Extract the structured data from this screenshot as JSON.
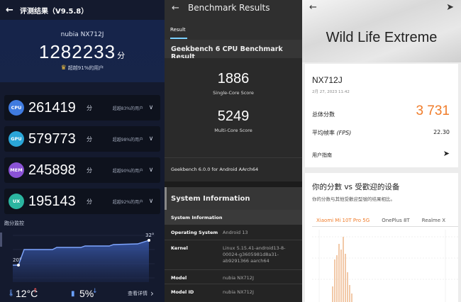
{
  "antutu": {
    "title": "评测结果（V9.5.8）",
    "device": "nubia NX712J",
    "total": "1282233",
    "total_unit": "分",
    "beat": "超越91%的用户",
    "rows": [
      {
        "badge": "CPU",
        "value": "261419",
        "unit": "分",
        "beat": "超越83%的用户",
        "color": "#3f7be0"
      },
      {
        "badge": "GPU",
        "value": "579773",
        "unit": "分",
        "beat": "超越98%的用户",
        "color": "#2aa6d8"
      },
      {
        "badge": "MEM",
        "value": "245898",
        "unit": "分",
        "beat": "超越90%的用户",
        "color": "#8a52d6"
      },
      {
        "badge": "UX",
        "value": "195143",
        "unit": "分",
        "beat": "超越92%的用户",
        "color": "#2bb5a0"
      }
    ],
    "monitor_label": "跑分监控",
    "temp_start": "20°",
    "temp_end": "32°",
    "temp_rise": "12°C",
    "battery_drop": "5%",
    "detail": "查看详情"
  },
  "geekbench": {
    "title": "Benchmark Results",
    "tab": "Result",
    "heading": "Geekbench 6 CPU Benchmark Result",
    "single_score": "1886",
    "single_label": "Single-Core Score",
    "multi_score": "5249",
    "multi_label": "Multi-Core Score",
    "version": "Geekbench 6.0.0 for Android AArch64",
    "sys_title": "System Information",
    "table_head": "System Information",
    "rows": [
      {
        "k": "Operating System",
        "v": "Android 13"
      },
      {
        "k": "Kernel",
        "v": "Linux 5.15.41-android13-8-00024-g3605981d8a31-ab9291366 aarch64"
      },
      {
        "k": "Model",
        "v": "nubia NX712J"
      },
      {
        "k": "Model ID",
        "v": "nubia NX712J"
      }
    ]
  },
  "threedmark": {
    "title": "Wild Life Extreme",
    "device": "NX712J",
    "date": "2月 27, 2023 11:42",
    "score_label": "总体分数",
    "score": "3 731",
    "fps_label": "平均帧率",
    "fps_label_en": "(FPS)",
    "fps": "22.30",
    "guide": "用户指南",
    "compare_title": "你的分數 vs 受歡迎的设备",
    "compare_sub": "你的分数与其他受歡迎型號的结果相比。",
    "tabs": [
      "Xiaomi Mi 10T Pro 5G",
      "OnePlus 8T",
      "Realme X"
    ]
  },
  "icons": {
    "back": "arrow-left-icon",
    "share": "share-icon",
    "chevron": "chevron-down-icon"
  }
}
